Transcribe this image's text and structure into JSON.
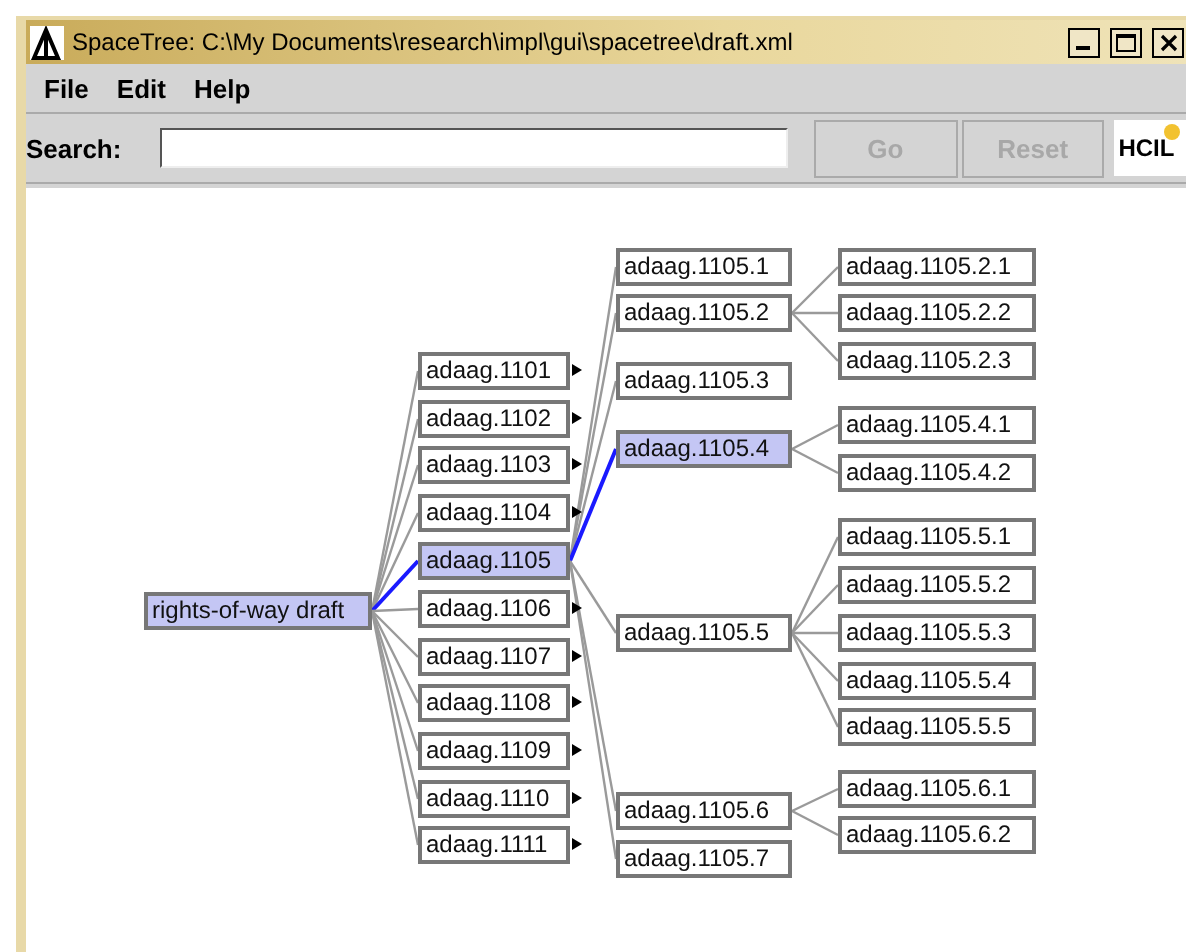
{
  "window": {
    "title": "SpaceTree: C:\\My Documents\\research\\impl\\gui\\spacetree\\draft.xml"
  },
  "menu": [
    "File",
    "Edit",
    "Help"
  ],
  "search": {
    "label": "Search:"
  },
  "buttons": [
    {
      "label": "Go",
      "disabled": true
    },
    {
      "label": "Reset",
      "disabled": true
    }
  ],
  "logo": {
    "text": "HCIL"
  },
  "tree": {
    "label": "rights-of-way draft",
    "selected": true,
    "collapsed": false,
    "children": [
      {
        "label": "adaag.1101",
        "selected": false,
        "collapsed": true
      },
      {
        "label": "adaag.1102",
        "selected": false,
        "collapsed": true
      },
      {
        "label": "adaag.1103",
        "selected": false,
        "collapsed": true
      },
      {
        "label": "adaag.1104",
        "selected": false,
        "collapsed": true
      },
      {
        "label": "adaag.1105",
        "selected": true,
        "collapsed": false,
        "children": [
          {
            "label": "adaag.1105.1",
            "selected": false,
            "collapsed": false
          },
          {
            "label": "adaag.1105.2",
            "selected": false,
            "collapsed": false,
            "children": [
              {
                "label": "adaag.1105.2.1",
                "selected": false,
                "collapsed": false
              },
              {
                "label": "adaag.1105.2.2",
                "selected": false,
                "collapsed": false
              },
              {
                "label": "adaag.1105.2.3",
                "selected": false,
                "collapsed": false
              }
            ]
          },
          {
            "label": "adaag.1105.3",
            "selected": false,
            "collapsed": false
          },
          {
            "label": "adaag.1105.4",
            "selected": true,
            "collapsed": false,
            "children": [
              {
                "label": "adaag.1105.4.1",
                "selected": false,
                "collapsed": false
              },
              {
                "label": "adaag.1105.4.2",
                "selected": false,
                "collapsed": false
              }
            ]
          },
          {
            "label": "adaag.1105.5",
            "selected": false,
            "collapsed": false,
            "children": [
              {
                "label": "adaag.1105.5.1",
                "selected": false,
                "collapsed": false
              },
              {
                "label": "adaag.1105.5.2",
                "selected": false,
                "collapsed": false
              },
              {
                "label": "adaag.1105.5.3",
                "selected": false,
                "collapsed": false
              },
              {
                "label": "adaag.1105.5.4",
                "selected": false,
                "collapsed": false
              },
              {
                "label": "adaag.1105.5.5",
                "selected": false,
                "collapsed": false
              }
            ]
          },
          {
            "label": "adaag.1105.6",
            "selected": false,
            "collapsed": false,
            "children": [
              {
                "label": "adaag.1105.6.1",
                "selected": false,
                "collapsed": false
              },
              {
                "label": "adaag.1105.6.2",
                "selected": false,
                "collapsed": false
              }
            ]
          },
          {
            "label": "adaag.1105.7",
            "selected": false,
            "collapsed": false
          }
        ]
      },
      {
        "label": "adaag.1106",
        "selected": false,
        "collapsed": true
      },
      {
        "label": "adaag.1107",
        "selected": false,
        "collapsed": true
      },
      {
        "label": "adaag.1108",
        "selected": false,
        "collapsed": true
      },
      {
        "label": "adaag.1109",
        "selected": false,
        "collapsed": true
      },
      {
        "label": "adaag.1110",
        "selected": false,
        "collapsed": true
      },
      {
        "label": "adaag.1111",
        "selected": false,
        "collapsed": true
      }
    ]
  }
}
